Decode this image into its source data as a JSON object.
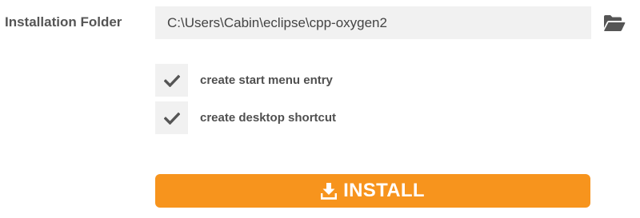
{
  "installation": {
    "folder_label": "Installation Folder",
    "folder_path": "C:\\Users\\Cabin\\eclipse\\cpp-oxygen2",
    "folder_icon": "folder-open-icon"
  },
  "options": [
    {
      "label": "create start menu entry",
      "checked": true,
      "icon": "checkmark-icon"
    },
    {
      "label": "create desktop shortcut",
      "checked": true,
      "icon": "checkmark-icon"
    }
  ],
  "install_button": {
    "label": "INSTALL",
    "icon": "download-icon",
    "color": "#f7941d"
  }
}
